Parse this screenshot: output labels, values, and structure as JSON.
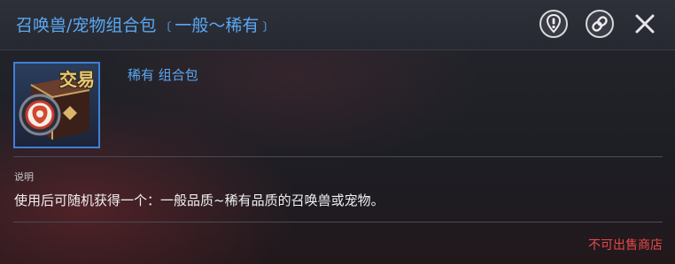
{
  "header": {
    "title": "召唤兽/宠物组合包",
    "bracket_open": "〔",
    "subtitle": "一般～稀有",
    "bracket_close": "〕"
  },
  "item": {
    "trade_tag": "交易",
    "rarity_line": "稀有 组合包",
    "icon": "lion-crest-box-icon"
  },
  "description": {
    "label": "说明",
    "text": "使用后可随机获得一个：一般品质~稀有品质的召唤兽或宠物。"
  },
  "footer": {
    "sell_status": "不可出售商店"
  },
  "icons": {
    "info": "info-shield-icon",
    "link": "link-chain-icon",
    "close": "close-icon"
  },
  "colors": {
    "title_blue": "#5aa8f2",
    "frame_blue": "#3f7fd8",
    "warning_red": "#e84848",
    "trade_gold": "#e7c87a"
  }
}
